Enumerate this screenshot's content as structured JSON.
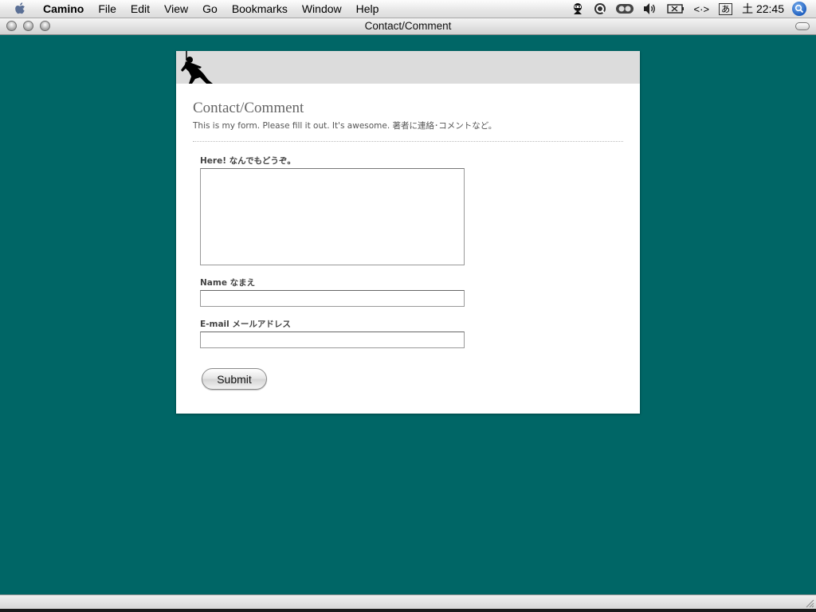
{
  "menubar": {
    "app_name": "Camino",
    "items": [
      "File",
      "Edit",
      "View",
      "Go",
      "Bookmarks",
      "Window",
      "Help"
    ],
    "status_icons": [
      "ninja-status-icon",
      "quicksilver-icon",
      "audio-cd-icon",
      "volume-icon",
      "battery-icon",
      "script-icon",
      "input-method-icon"
    ],
    "input_method_label": "あ",
    "clock": "土 22:45",
    "script_label": "<·>"
  },
  "window": {
    "title": "Contact/Comment"
  },
  "page": {
    "title": "Contact/Comment",
    "subtitle": "This is my form. Please fill it out. It's awesome. 著者に連絡･コメントなど。",
    "form": {
      "message_label": "Here! なんでもどうぞ。",
      "message_value": "",
      "name_label": "Name なまえ",
      "name_value": "",
      "email_label": "E-mail メールアドレス",
      "email_value": "",
      "submit_label": "Submit"
    }
  },
  "colors": {
    "desktop_background": "#006666",
    "page_header": "#dcdcdc",
    "page_background": "#ffffff"
  }
}
